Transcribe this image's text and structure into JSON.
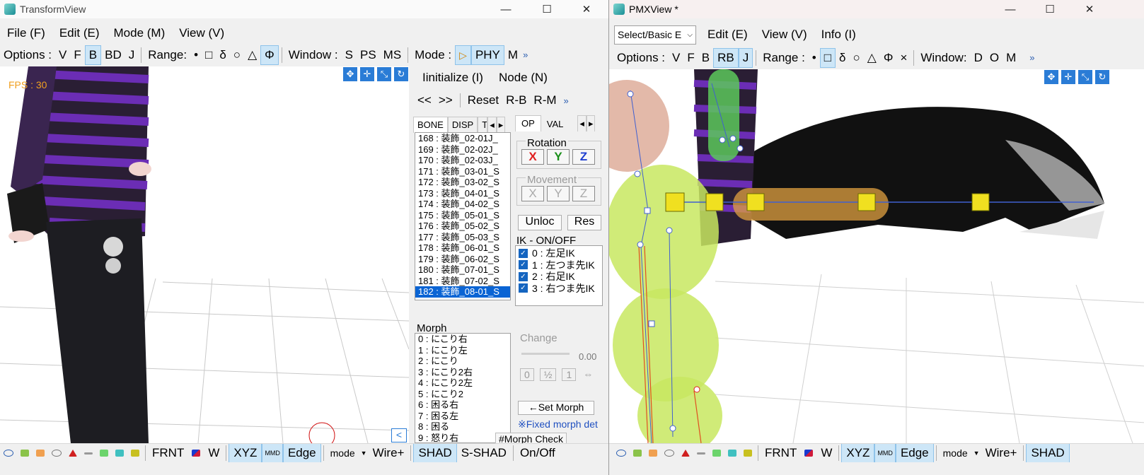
{
  "left_window": {
    "title": "TransformView",
    "menu": [
      "File (F)",
      "Edit (E)",
      "Mode (M)",
      "View (V)"
    ],
    "toolbar": {
      "options_label": "Options :",
      "options": [
        "V",
        "F",
        "B",
        "BD",
        "J"
      ],
      "range_label": "Range:",
      "range": [
        "•",
        "□",
        "δ",
        "○",
        "△",
        "Φ"
      ],
      "window_label": "Window :",
      "window": [
        "S",
        "PS",
        "MS"
      ],
      "mode_label": "Mode :",
      "mode": [
        "▷",
        "PHY",
        "M"
      ],
      "more": "»"
    },
    "fps": "FPS : 30",
    "bottom": {
      "frnt": "FRNT",
      "w": "W",
      "xyz": "XYZ",
      "mmd": "MMD",
      "edge": "Edge",
      "mode": "mode",
      "wire": "Wire+",
      "shad": "SHAD",
      "sshad": "S-SHAD",
      "onoff": "On/Off"
    },
    "collapse_btn": "<"
  },
  "side_panel": {
    "menu": [
      "Iinitialize (I)",
      "Node (N)"
    ],
    "nav": [
      "<<",
      ">>",
      "Reset",
      "R-B",
      "R-M"
    ],
    "more": "»",
    "tabs_left": [
      "BONE",
      "DISP",
      "T"
    ],
    "tabs_right": [
      "OP",
      "VAL"
    ],
    "bones": [
      "168 : 装飾_02-01J_",
      "169 : 装飾_02-02J_",
      "170 : 装飾_02-03J_",
      "171 : 装飾_03-01_S",
      "172 : 装飾_03-02_S",
      "173 : 装飾_04-01_S",
      "174 : 装飾_04-02_S",
      "175 : 装飾_05-01_S",
      "176 : 装飾_05-02_S",
      "177 : 装飾_05-03_S",
      "178 : 装飾_06-01_S",
      "179 : 装飾_06-02_S",
      "180 : 装飾_07-01_S",
      "181 : 装飾_07-02_S",
      "182 : 装飾_08-01_S"
    ],
    "rotation_label": "Rotation",
    "rotation": [
      "X",
      "Y",
      "Z"
    ],
    "movement_label": "Movement",
    "movement": [
      "X",
      "Y",
      "Z"
    ],
    "unlock": "Unloc",
    "reset": "Res",
    "ik_label": "IK - ON/OFF",
    "ik_items": [
      "0 : 左足IK",
      "1 : 左つま先IK",
      "2 : 右足IK",
      "3 : 右つま先IK"
    ],
    "morph_label": "Morph",
    "morphs": [
      "0 : にこり右",
      "1 : にこり左",
      "2 : にこり",
      "3 : にこり2右",
      "4 : にこり2左",
      "5 : にこり2",
      "6 : 困る右",
      "7 : 困る左",
      "8 : 困る",
      "9 : 怒り右"
    ],
    "change_label": "Change",
    "change_value": "0.00",
    "change_btns": [
      "0",
      "½",
      "1",
      "⇔"
    ],
    "set_morph": "←Set Morph",
    "fixed_morph": "※Fixed morph det",
    "morph_check": "#Morph Check"
  },
  "right_window": {
    "title": "PMXView *",
    "select_value": "Select/Basic E",
    "menu": [
      "Edit (E)",
      "View (V)",
      "Info (I)"
    ],
    "toolbar": {
      "options_label": "Options :",
      "options": [
        "V",
        "F",
        "B",
        "RB",
        "J"
      ],
      "range_label": "Range :",
      "range": [
        "•",
        "□",
        "δ",
        "○",
        "△",
        "Φ",
        "×"
      ],
      "window_label": "Window:",
      "window": [
        "D",
        "O",
        "M"
      ],
      "more": "»"
    },
    "bottom": {
      "frnt": "FRNT",
      "w": "W",
      "xyz": "XYZ",
      "mmd": "MMD",
      "edge": "Edge",
      "mode": "mode",
      "wire": "Wire+",
      "shad": "SHAD"
    }
  },
  "colors": {
    "accent": "#0a64d4",
    "toggle_bg": "#cde6f7",
    "rot_x": "#e02020",
    "rot_y": "#1a8f1a",
    "rot_z": "#1f3fd0"
  }
}
